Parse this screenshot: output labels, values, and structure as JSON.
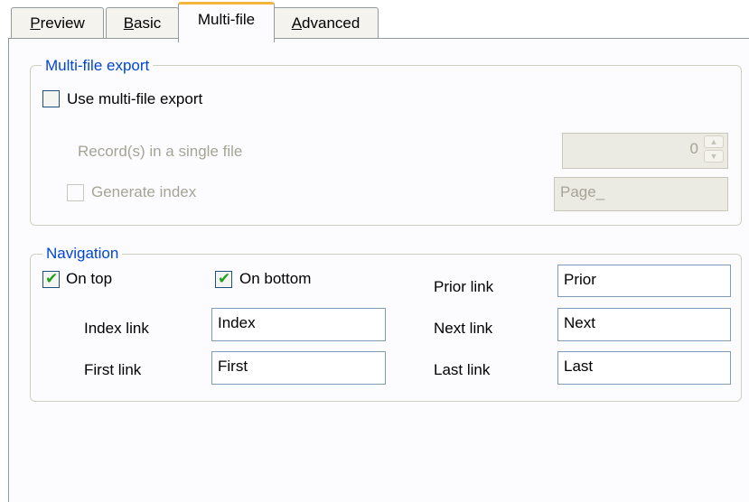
{
  "tabs": [
    {
      "label": "Preview",
      "mnemonic": "P"
    },
    {
      "label": "Basic",
      "mnemonic": "B"
    },
    {
      "label": "Multi-file",
      "mnemonic": ""
    },
    {
      "label": "Advanced",
      "mnemonic": "A"
    }
  ],
  "active_tab": "Multi-file",
  "multi_file": {
    "legend": "Multi-file export",
    "use_label": "Use multi-file export",
    "use_checked": false,
    "records_label": "Record(s) in a single file",
    "records_value": "0",
    "generate_index_label": "Generate index",
    "generate_index_checked": false,
    "index_prefix_value": "Page_"
  },
  "navigation": {
    "legend": "Navigation",
    "on_top_label": "On top",
    "on_top_checked": true,
    "on_bottom_label": "On bottom",
    "on_bottom_checked": true,
    "prior_label": "Prior link",
    "prior_value": "Prior",
    "index_label": "Index link",
    "index_value": "Index",
    "next_label": "Next link",
    "next_value": "Next",
    "first_label": "First link",
    "first_value": "First",
    "last_label": "Last link",
    "last_value": "Last"
  },
  "colors": {
    "legend": "#0046d5",
    "active_tab_accent": "#f5b43c",
    "check_mark": "#21a121",
    "disabled_text": "#a5a496"
  }
}
